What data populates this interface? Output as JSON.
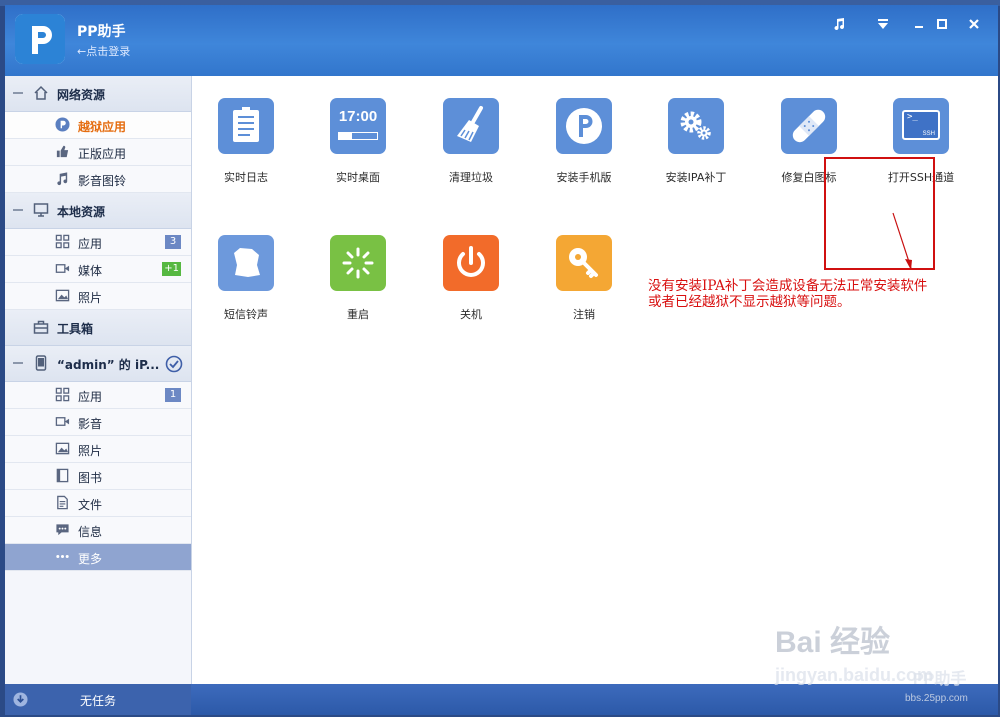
{
  "app": {
    "title": "PP助手",
    "login_label": "←点击登录"
  },
  "sidebar": {
    "network": {
      "title": "网络资源",
      "items": [
        {
          "label": "越狱应用",
          "icon": "pp-icon",
          "active": true
        },
        {
          "label": "正版应用",
          "icon": "thumb-icon"
        },
        {
          "label": "影音图铃",
          "icon": "music-note-icon"
        }
      ]
    },
    "local": {
      "title": "本地资源",
      "items": [
        {
          "label": "应用",
          "icon": "grid-icon",
          "badge": "3"
        },
        {
          "label": "媒体",
          "icon": "video-icon",
          "badge": "+1"
        },
        {
          "label": "照片",
          "icon": "photo-icon"
        }
      ]
    },
    "toolbox": {
      "title": "工具箱"
    },
    "device": {
      "title": "“admin” 的 iP...",
      "items": [
        {
          "label": "应用",
          "icon": "grid-icon",
          "badge": "1"
        },
        {
          "label": "影音",
          "icon": "video-icon"
        },
        {
          "label": "照片",
          "icon": "photo-icon"
        },
        {
          "label": "图书",
          "icon": "book-icon"
        },
        {
          "label": "文件",
          "icon": "file-icon"
        },
        {
          "label": "信息",
          "icon": "message-icon"
        },
        {
          "label": "更多",
          "icon": "more-icon"
        }
      ]
    }
  },
  "footer": {
    "task_status": "无任务"
  },
  "tools": [
    {
      "label": "实时日志",
      "icon": "log-icon",
      "color": "#5d8fd8"
    },
    {
      "label": "实时桌面",
      "icon": "clock-display-icon",
      "color": "#5d8fd8",
      "icon_text": "17:00"
    },
    {
      "label": "清理垃圾",
      "icon": "broom-icon",
      "color": "#5d8fd8"
    },
    {
      "label": "安装手机版",
      "icon": "pp-logo-icon",
      "color": "#5d8fd8"
    },
    {
      "label": "安装IPA补丁",
      "icon": "gears-icon",
      "color": "#5d8fd8"
    },
    {
      "label": "修复白图标",
      "icon": "bandage-icon",
      "color": "#5d8fd8"
    },
    {
      "label": "打开SSH通道",
      "icon": "terminal-icon",
      "color": "#5d8fd8",
      "icon_text": "SSH"
    },
    {
      "label": "短信铃声",
      "icon": "bell-icon",
      "color": "#6d99dc"
    },
    {
      "label": "重启",
      "icon": "restart-icon",
      "color": "#79c144"
    },
    {
      "label": "关机",
      "icon": "power-icon",
      "color": "#f26b2a"
    },
    {
      "label": "注销",
      "icon": "key-icon",
      "color": "#f4a734"
    }
  ],
  "annotation": {
    "line1": "没有安装IPA补丁会造成设备无法正常安装软件",
    "line2": "或者已经越狱不显示越狱等问题。",
    "color": "#d81010"
  },
  "watermark": {
    "logo_text": "Bai  经验",
    "url": "jingyan.baidu.com",
    "overlay_brand": "PP助手",
    "overlay_url": "bbs.25pp.com"
  }
}
